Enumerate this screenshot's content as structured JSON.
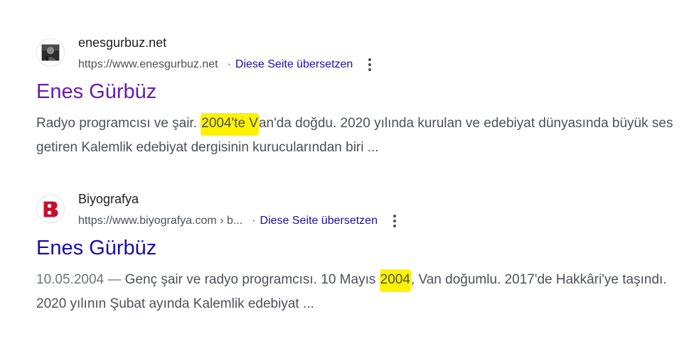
{
  "results": [
    {
      "site_name": "enesgurbuz.net",
      "url": "https://www.enesgurbuz.net",
      "separator": "·",
      "translate_label": "Diese Seite übersetzen",
      "title": "Enes Gürbüz",
      "snippet_before": "Radyo programcısı ve şair. ",
      "snippet_highlight": "2004'te V",
      "snippet_after": "an'da doğdu. 2020 yılında kurulan ve edebiyat dünyasında büyük ses getiren Kalemlik edebiyat dergisinin kurucularından biri ...",
      "favicon": "person-photo-icon",
      "title_color": "#681da8"
    },
    {
      "site_name": "Biyografya",
      "url": "https://www.biyografya.com › b...",
      "separator": "·",
      "translate_label": "Diese Seite übersetzen",
      "title": "Enes Gürbüz",
      "snippet_date": "10.05.2004 — ",
      "snippet_before": "Genç şair ve radyo programcısı. 10 Mayıs ",
      "snippet_highlight": "2004",
      "snippet_after": ", Van doğumlu. 2017'de Hakkâri'ye taşındı. 2020 yılının Şubat ayında Kalemlik edebiyat ...",
      "favicon": "biyografya-b-logo-icon",
      "title_color": "#1a0dab"
    }
  ],
  "colors": {
    "highlight": "#fff200",
    "link": "#1a0dab",
    "visited": "#681da8",
    "text": "#4d5156"
  }
}
